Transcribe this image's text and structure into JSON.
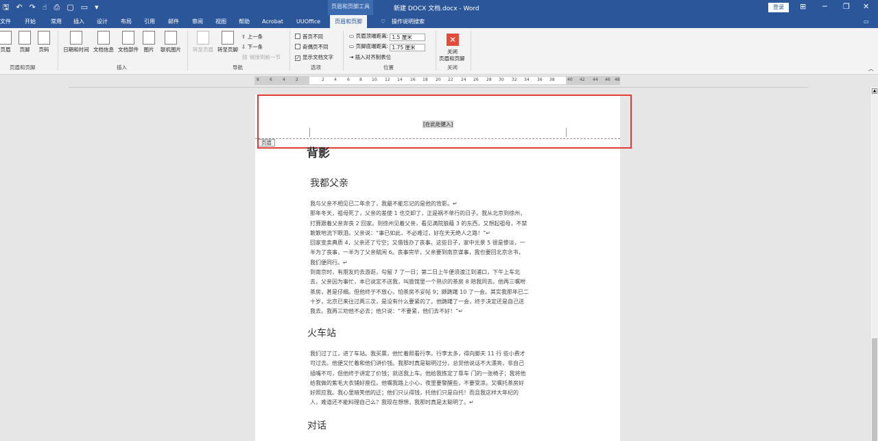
{
  "titlebar": {
    "context_tools": "页眉和页脚工具",
    "doc_title": "新建 DOCX 文档.docx  -  Word",
    "login": "登录"
  },
  "tabs": [
    "文件",
    "开始",
    "常用",
    "插入",
    "设计",
    "布局",
    "引用",
    "邮件",
    "审阅",
    "视图",
    "帮助",
    "Acrobat",
    "UUOffice",
    "页眉和页脚",
    "操作说明搜索"
  ],
  "ribbon": {
    "hf_group": {
      "header": "页眉",
      "footer": "页脚",
      "page_number": "页码",
      "label": "页眉和页脚"
    },
    "insert_group": {
      "datetime": "日期和时间",
      "docinfo": "文档信息",
      "docparts": "文档部件",
      "picture": "图片",
      "online_picture": "联机图片",
      "label": "插入"
    },
    "nav_group": {
      "goto_header": "转至页眉",
      "goto_footer": "转至页脚",
      "prev": "上一条",
      "next": "下一条",
      "link_prev": "链接到前一节",
      "label": "导航"
    },
    "options_group": {
      "first_page": "首页不同",
      "odd_even": "奇偶页不同",
      "show_text": "显示文档文字",
      "label": "选项"
    },
    "position_group": {
      "header_top": "页眉顶端距离:",
      "header_top_val": "1.5 厘米",
      "footer_bottom": "页脚底端距离:",
      "footer_bottom_val": "1.75 厘米",
      "insert_align_tab": "插入对齐制表位",
      "label": "位置"
    },
    "close_group": {
      "close": "关闭",
      "close2": "页眉和页脚",
      "label": "关闭"
    }
  },
  "ruler_numbers": [
    "8",
    "6",
    "4",
    "2",
    "2",
    "4",
    "6",
    "8",
    "10",
    "12",
    "14",
    "16",
    "18",
    "20",
    "22",
    "24",
    "26",
    "28",
    "30",
    "32",
    "34",
    "36",
    "38",
    "40",
    "42",
    "44",
    "46",
    "48"
  ],
  "document": {
    "header_placeholder": "[在此处键入]",
    "header_tag": "页眉",
    "heading1": "背影",
    "heading2": "我都父亲",
    "para1": [
      "我与父亲不相见已二年余了，我最不能忘记的是他的背影。↵",
      "那年冬天，祖母死了，父亲的差使 1 也交卸了，正是祸不单行的日子。我从北京到徐州，",
      "打算跟着父亲奔丧 2 回家。到徐州见着父亲，看见满院狼藉 3 的东西，又想起祖母，不禁",
      "簌簌地流下眼泪。父亲说：“事已如此，不必难过，好在天无绝人之路！”↵",
      "回家变卖典质 4，父亲还了亏空；又借钱办了丧事。这些日子，家中光景 5 很是惨淡，一",
      "半为了丧事，一半为了父亲赋闲 6。丧事完毕，父亲要到南京谋事，我也要回北京念书，",
      "我们便同行。↵",
      "到南京时，有朋友约去游逛，勾留 7 了一日；第二日上午便须渡江到浦口，下午上车北",
      "去。父亲因为事忙，本已说定不送我，叫旅馆里一个熟识的茶房 8 陪我同去。他再三嘱咐",
      "茶房，甚是仔细。但他终于不放心，怕茶房不妥帖 9；颇踌躇 10 了一会。其实我那年已二",
      "十岁，北京已来往过两三次，是没有什么要紧的了。他踌躇了一会，终于决定还是自己送",
      "我去。我再三劝他不必去；他只说：“不要紧，他们去不好！”↵"
    ],
    "heading3": "火车站",
    "para2": [
      "我们过了江，进了车站。我买票，他忙着照看行李。行李太多，得向脚夫 11 行 些小费才",
      "可过去。他便又忙着和他们讲价钱。我那时真是聪明过分，总觉他说话不大漂亮，非自己",
      "插嘴不可，但他终于讲定了价钱；就送我上车。他给我拣定了靠车 门的一张椅子；我将他",
      "给我做的紫毛大衣铺好座位。他嘱我路上小心，夜里要警醒些，不要受凉。又嘱托茶房好",
      "好照应我。我心里暗笑他的迂；他们只认得钱，托他们只是白托！而且我这样大年纪的",
      "人，难道还不能料理自己么？我现在想想，我那时真是太聪明了。↵"
    ],
    "heading4": "对话"
  }
}
